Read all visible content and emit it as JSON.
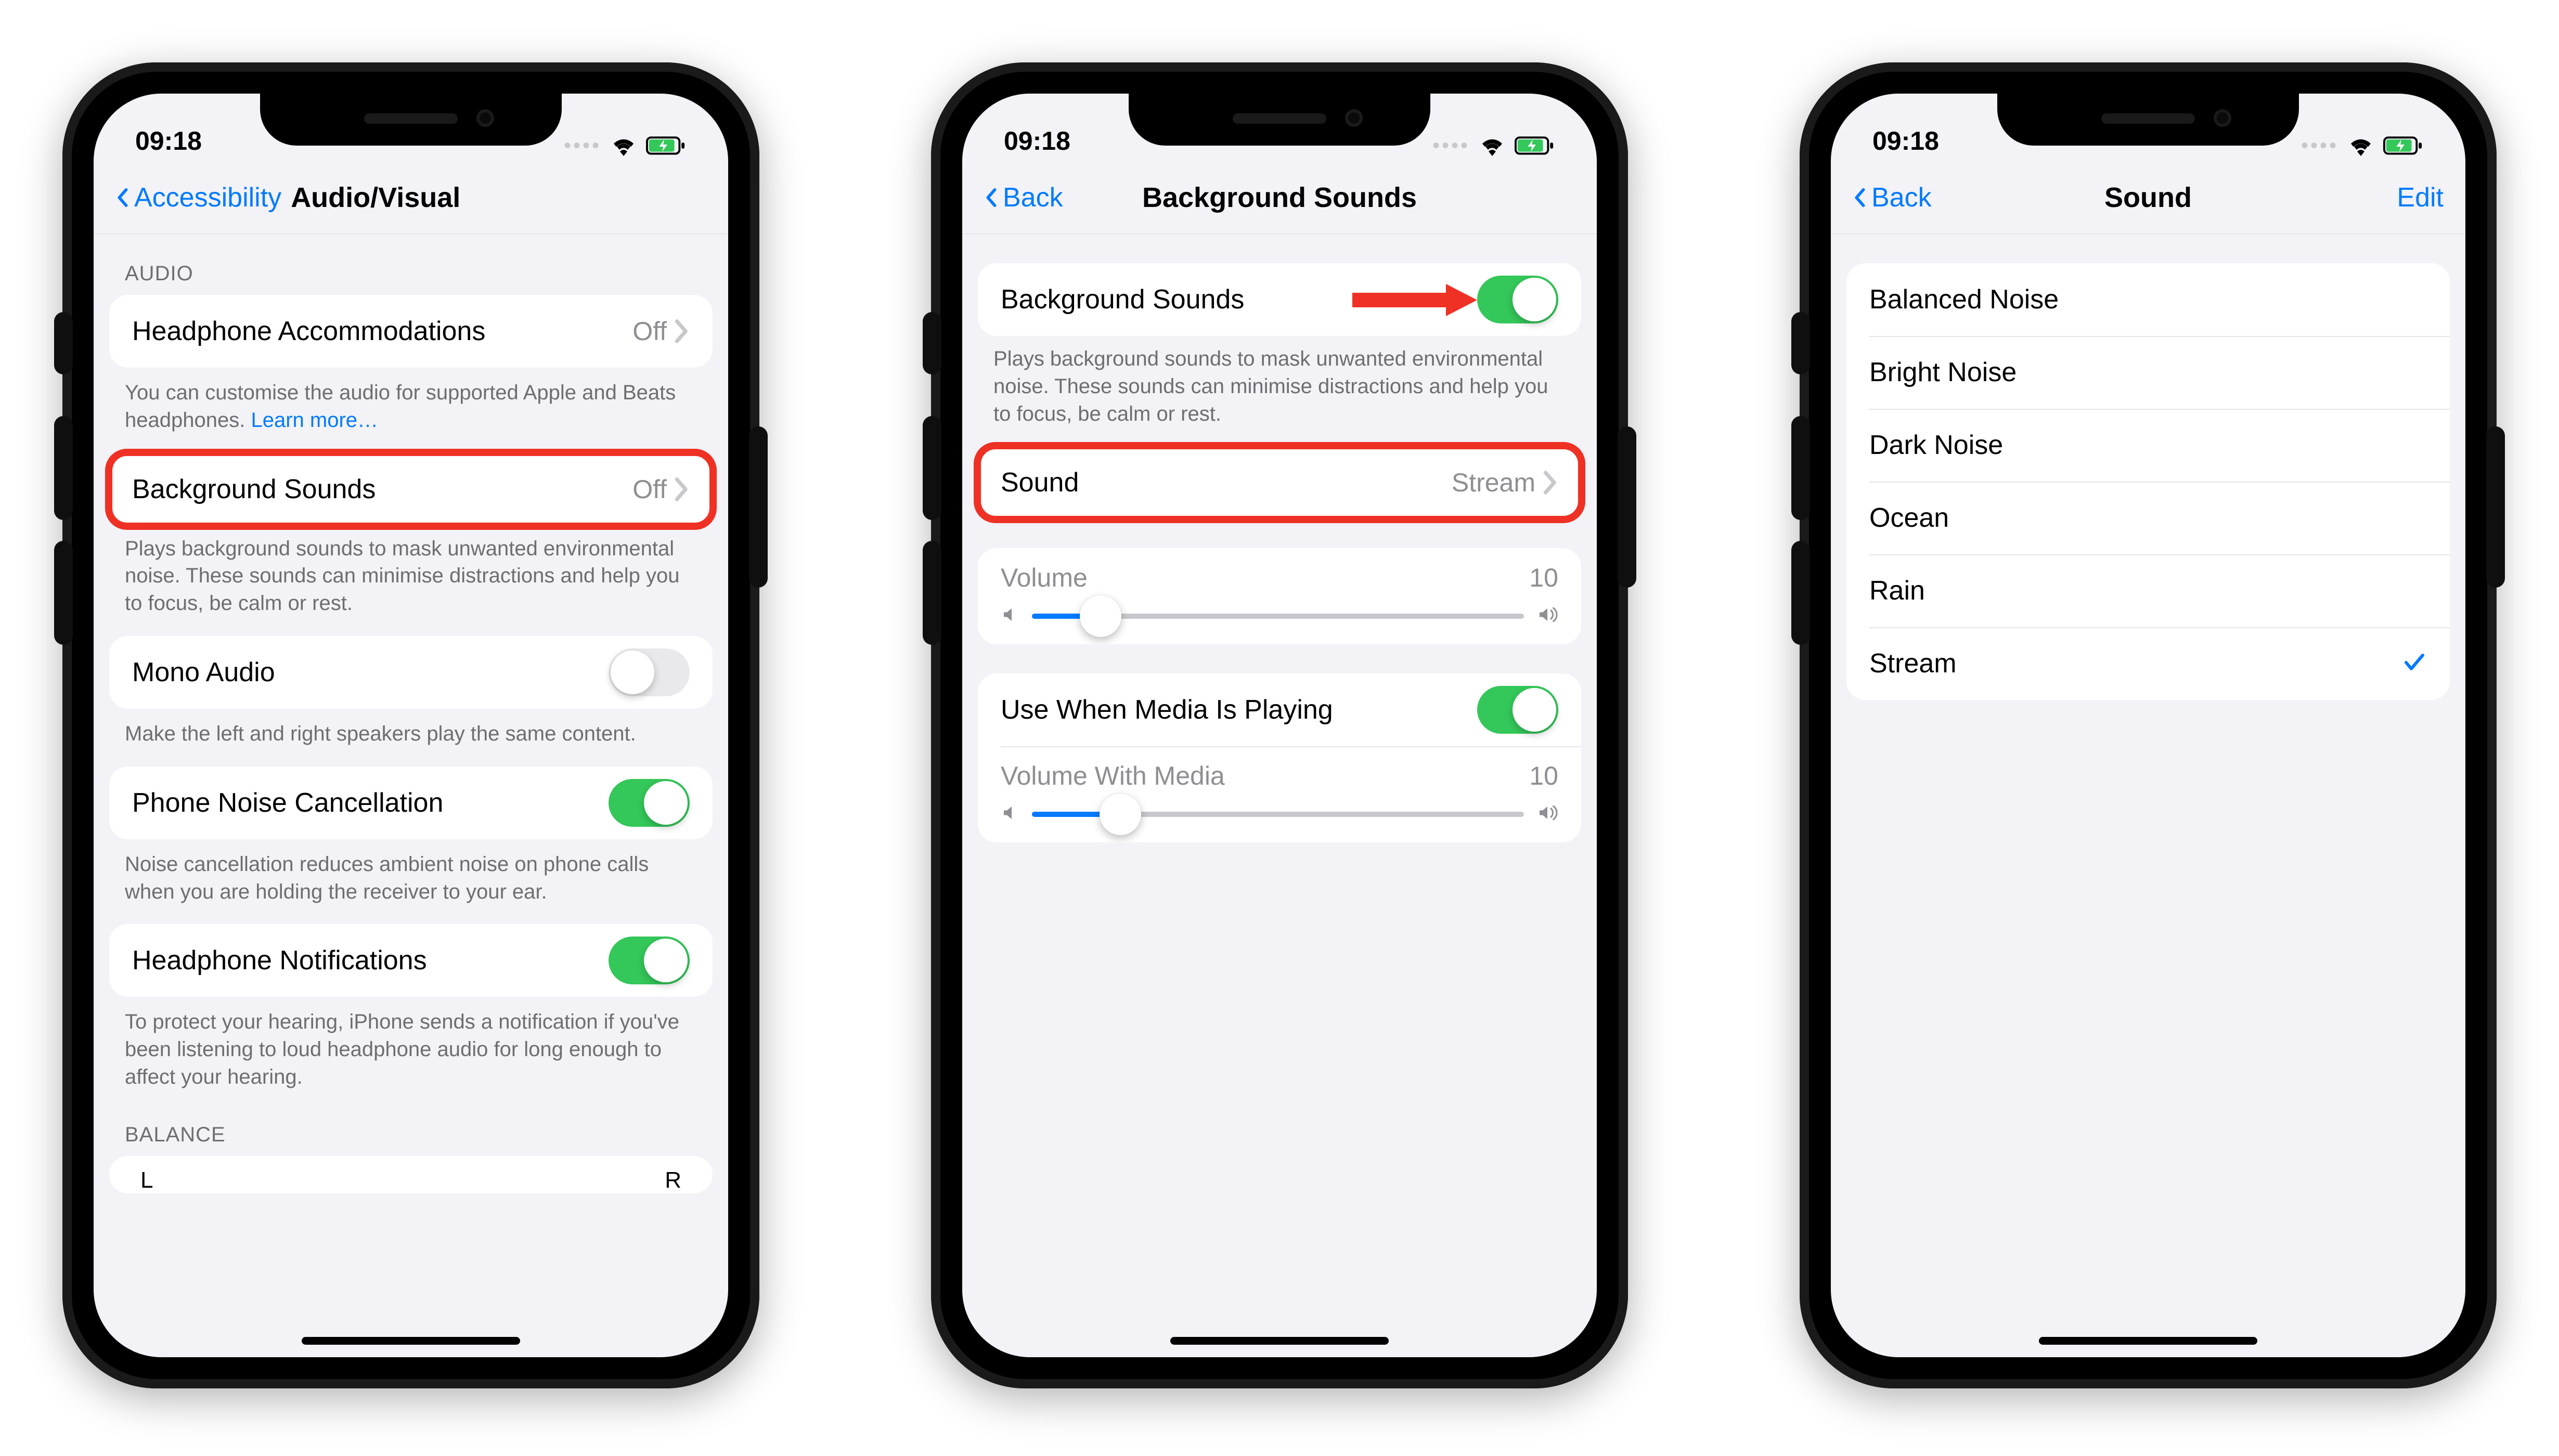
{
  "status": {
    "time": "09:18"
  },
  "phone1": {
    "nav_back": "Accessibility",
    "nav_title": "Audio/Visual",
    "section_audio_header": "AUDIO",
    "headphone_accommodations": {
      "label": "Headphone Accommodations",
      "value": "Off"
    },
    "headphone_footer_a": "You can customise the audio for supported Apple and Beats headphones. ",
    "headphone_footer_link": "Learn more…",
    "background_sounds": {
      "label": "Background Sounds",
      "value": "Off"
    },
    "background_footer": "Plays background sounds to mask unwanted environmental noise. These sounds can minimise distractions and help you to focus, be calm or rest.",
    "mono_audio": {
      "label": "Mono Audio"
    },
    "mono_footer": "Make the left and right speakers play the same content.",
    "noise_cancel": {
      "label": "Phone Noise Cancellation"
    },
    "noise_footer": "Noise cancellation reduces ambient noise on phone calls when you are holding the receiver to your ear.",
    "headphone_notify": {
      "label": "Headphone Notifications"
    },
    "notify_footer": "To protect your hearing, iPhone sends a notification if you've been listening to loud headphone audio for long enough to affect your hearing.",
    "balance_header": "BALANCE",
    "balance_left": "L",
    "balance_right": "R"
  },
  "phone2": {
    "nav_back": "Back",
    "nav_title": "Background Sounds",
    "toggle_label": "Background Sounds",
    "toggle_footer": "Plays background sounds to mask unwanted environmental noise. These sounds can minimise distractions and help you to focus, be calm or rest.",
    "sound_row": {
      "label": "Sound",
      "value": "Stream"
    },
    "volume": {
      "label": "Volume",
      "value": "10",
      "percent": 14
    },
    "media_toggle": {
      "label": "Use When Media Is Playing"
    },
    "volume_media": {
      "label": "Volume With Media",
      "value": "10",
      "percent": 18
    }
  },
  "phone3": {
    "nav_back": "Back",
    "nav_title": "Sound",
    "nav_right": "Edit",
    "options": [
      {
        "label": "Balanced Noise",
        "selected": false
      },
      {
        "label": "Bright Noise",
        "selected": false
      },
      {
        "label": "Dark Noise",
        "selected": false
      },
      {
        "label": "Ocean",
        "selected": false
      },
      {
        "label": "Rain",
        "selected": false
      },
      {
        "label": "Stream",
        "selected": true
      }
    ]
  }
}
